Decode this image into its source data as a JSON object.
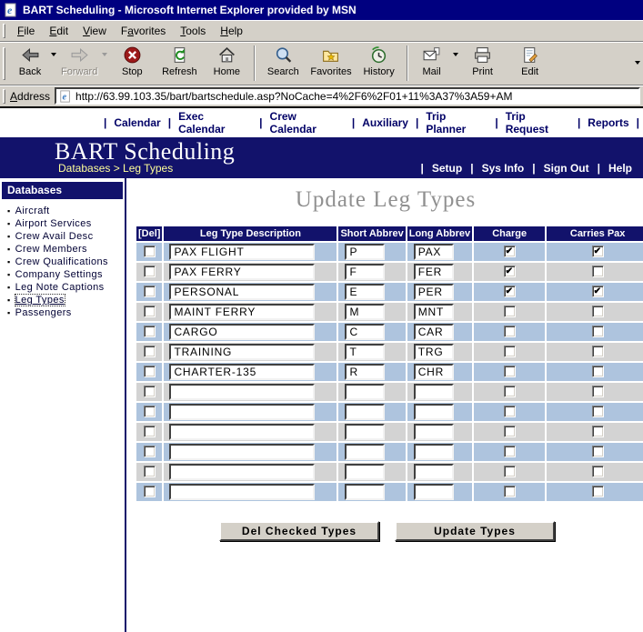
{
  "window": {
    "title": "BART Scheduling - Microsoft Internet Explorer provided by MSN"
  },
  "menubar": {
    "items": [
      {
        "pre": "",
        "key": "F",
        "post": "ile"
      },
      {
        "pre": "",
        "key": "E",
        "post": "dit"
      },
      {
        "pre": "",
        "key": "V",
        "post": "iew"
      },
      {
        "pre": "F",
        "key": "a",
        "post": "vorites"
      },
      {
        "pre": "",
        "key": "T",
        "post": "ools"
      },
      {
        "pre": "",
        "key": "H",
        "post": "elp"
      }
    ]
  },
  "toolbar": {
    "buttons": [
      {
        "label": "Back"
      },
      {
        "label": "Forward"
      },
      {
        "label": "Stop"
      },
      {
        "label": "Refresh"
      },
      {
        "label": "Home"
      },
      {
        "label": "Search"
      },
      {
        "label": "Favorites"
      },
      {
        "label": "History"
      },
      {
        "label": "Mail"
      },
      {
        "label": "Print"
      },
      {
        "label": "Edit"
      }
    ]
  },
  "addressbar": {
    "label": "Address",
    "url": "http://63.99.103.35/bart/bartschedule.asp?NoCache=4%2F6%2F01+11%3A37%3A59+AM"
  },
  "topnav": {
    "separator": "|",
    "items": [
      "Calendar",
      "Exec Calendar",
      "Crew Calendar",
      "Auxiliary",
      "Trip Planner",
      "Trip Request",
      "Reports"
    ]
  },
  "banner": {
    "title": "BART Scheduling",
    "breadcrumb": "Databases > Leg Types",
    "separator": "|",
    "links": [
      "Setup",
      "Sys Info",
      "Sign Out",
      "Help"
    ]
  },
  "sidebar": {
    "header": "Databases",
    "items": [
      {
        "label": "Aircraft",
        "selected": false
      },
      {
        "label": "Airport Services",
        "selected": false
      },
      {
        "label": "Crew Avail Desc",
        "selected": false
      },
      {
        "label": "Crew Members",
        "selected": false
      },
      {
        "label": "Crew Qualifications",
        "selected": false
      },
      {
        "label": "Company Settings",
        "selected": false
      },
      {
        "label": "Leg Note Captions",
        "selected": false
      },
      {
        "label": "Leg Types",
        "selected": true
      },
      {
        "label": "Passengers",
        "selected": false
      }
    ]
  },
  "main": {
    "title": "Update Leg Types",
    "table": {
      "headers": [
        "[Del]",
        "Leg Type Description",
        "Short Abbrev",
        "Long Abbrev",
        "Charge",
        "Carries Pax"
      ],
      "rows": [
        {
          "del": false,
          "description": "PAX FLIGHT",
          "short": "P",
          "long": "PAX",
          "charge": true,
          "carries_pax": true
        },
        {
          "del": false,
          "description": "PAX FERRY",
          "short": "F",
          "long": "FER",
          "charge": true,
          "carries_pax": false
        },
        {
          "del": false,
          "description": "PERSONAL",
          "short": "E",
          "long": "PER",
          "charge": true,
          "carries_pax": true
        },
        {
          "del": false,
          "description": "MAINT FERRY",
          "short": "M",
          "long": "MNT",
          "charge": false,
          "carries_pax": false
        },
        {
          "del": false,
          "description": "CARGO",
          "short": "C",
          "long": "CAR",
          "charge": false,
          "carries_pax": false
        },
        {
          "del": false,
          "description": "TRAINING",
          "short": "T",
          "long": "TRG",
          "charge": false,
          "carries_pax": false
        },
        {
          "del": false,
          "description": "CHARTER-135",
          "short": "R",
          "long": "CHR",
          "charge": false,
          "carries_pax": false
        },
        {
          "del": false,
          "description": "",
          "short": "",
          "long": "",
          "charge": false,
          "carries_pax": false
        },
        {
          "del": false,
          "description": "",
          "short": "",
          "long": "",
          "charge": false,
          "carries_pax": false
        },
        {
          "del": false,
          "description": "",
          "short": "",
          "long": "",
          "charge": false,
          "carries_pax": false
        },
        {
          "del": false,
          "description": "",
          "short": "",
          "long": "",
          "charge": false,
          "carries_pax": false
        },
        {
          "del": false,
          "description": "",
          "short": "",
          "long": "",
          "charge": false,
          "carries_pax": false
        },
        {
          "del": false,
          "description": "",
          "short": "",
          "long": "",
          "charge": false,
          "carries_pax": false
        }
      ]
    },
    "buttons": {
      "delete": "Del Checked Types",
      "update": "Update Types"
    }
  },
  "colors": {
    "titlebar_navy": "#000080",
    "banner_navy": "#12126b",
    "row_blue": "#aec4de",
    "row_gray": "#d3d3d3",
    "breadcrumb_yellow": "#ffff99",
    "link_navy": "#000066",
    "title_gray": "#909090"
  }
}
